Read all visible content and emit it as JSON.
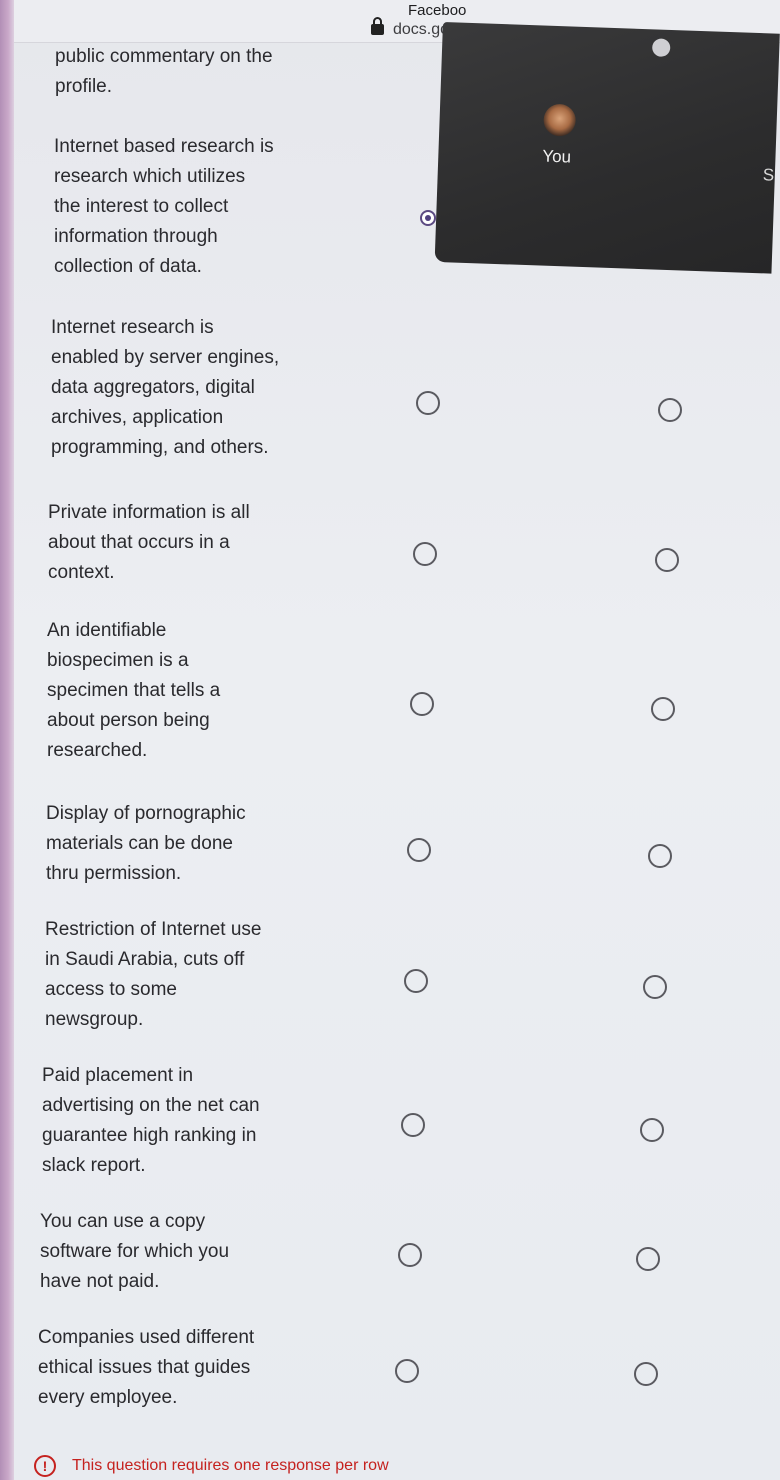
{
  "browser": {
    "tab_title": "Faceboo",
    "url": "docs.goo"
  },
  "call": {
    "participant_label": "You",
    "edge_char": "S"
  },
  "questions": [
    {
      "text": "public commentary on the\nprofile."
    },
    {
      "text": "Internet based research is\nresearch which utilizes\nthe interest to collect\ninformation through\ncollection of data."
    },
    {
      "text": "Internet research is\nenabled by server engines,\ndata aggregators, digital\narchives, application\nprogramming, and others."
    },
    {
      "text": "Private information is all\nabout that occurs in a\ncontext."
    },
    {
      "text": "An identifiable\nbiospecimen is a\nspecimen that tells a\nabout person being\nresearched."
    },
    {
      "text": "Display of pornographic\nmaterials can be done\nthru permission."
    },
    {
      "text": "Restriction of Internet use\nin Saudi Arabia, cuts off\naccess to some\nnewsgroup."
    },
    {
      "text": "Paid placement in\nadvertising on the net can\nguarantee high ranking in\nslack report."
    },
    {
      "text": "You can use a copy\nsoftware for which you\nhave not paid."
    },
    {
      "text": "Companies used different\nethical issues that guides\nevery employee."
    }
  ],
  "validation": {
    "icon": "!",
    "message": "This question requires one response per row"
  },
  "colors": {
    "error": "#c5221f",
    "radio_selected": "#4e3f7e",
    "radio_border": "#5a5a60"
  }
}
